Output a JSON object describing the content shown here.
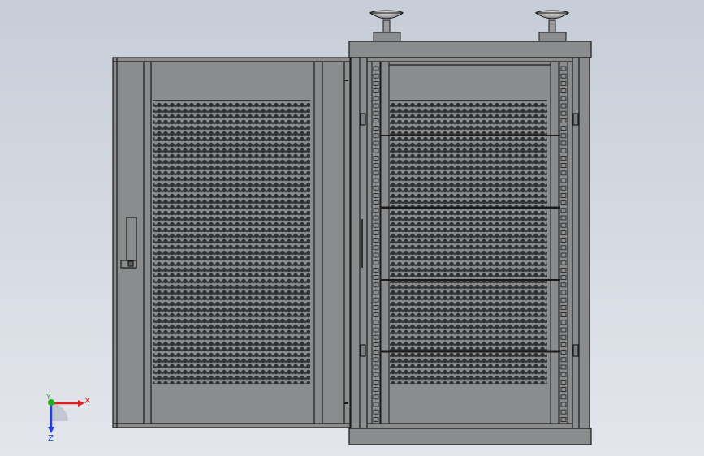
{
  "viewport": {
    "background_top": "#c7cdd7",
    "background_bottom": "#e3e6ec",
    "model_fill": "#8a8c8e",
    "model_fill_dark": "#7b7d80",
    "model_edge": "#1a1a1a",
    "perforation_fill": "#2f3032"
  },
  "triad": {
    "x_label": "X",
    "y_label": "Y",
    "z_label": "Z",
    "x_color": "#e02020",
    "y_color": "#20b020",
    "z_color": "#2040e0"
  },
  "parts": {
    "door": "open-front-door",
    "cabinet": "cabinet-body",
    "feet": "leveling-feet",
    "rails": "mounting-rails",
    "shelves": "shelf-bars"
  }
}
